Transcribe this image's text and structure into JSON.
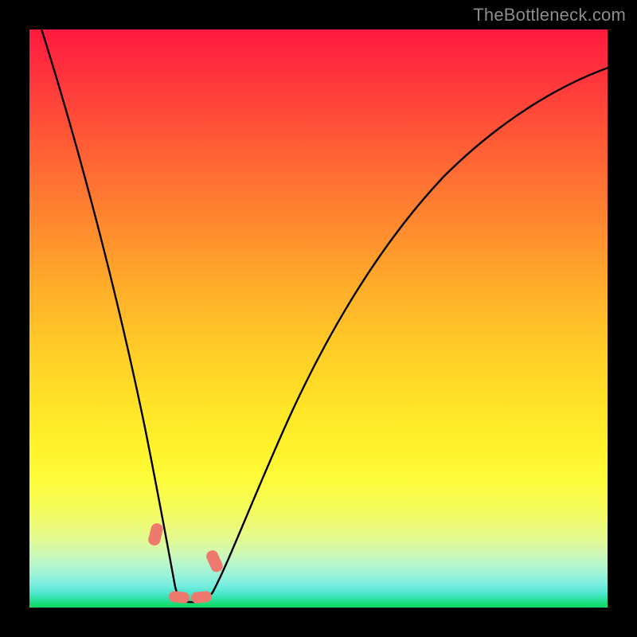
{
  "watermark": "TheBottleneck.com",
  "chart_data": {
    "type": "line",
    "title": "",
    "xlabel": "",
    "ylabel": "",
    "xlim": [
      0,
      100
    ],
    "ylim": [
      0,
      100
    ],
    "grid": false,
    "legend": false,
    "note": "Gradient-background bottleneck curve. x is normalized horizontal position (0–100), y is normalized vertical distance from the bottom green baseline (0 = at baseline, 100 = top). Values are estimated from pixel positions.",
    "series": [
      {
        "name": "bottleneck-curve",
        "x": [
          2,
          5,
          8,
          11,
          14,
          17,
          20,
          22,
          24,
          26,
          27.5,
          29,
          31,
          34,
          38,
          43,
          49,
          56,
          64,
          73,
          83,
          92,
          98
        ],
        "y": [
          100,
          88,
          76,
          64,
          52,
          40,
          28,
          18,
          10,
          4,
          0.8,
          0.5,
          1.5,
          4,
          9,
          17,
          27,
          39,
          52,
          64,
          75,
          83,
          88
        ]
      }
    ],
    "markers": [
      {
        "x": 22.2,
        "y": 13.0,
        "shape": "capsule"
      },
      {
        "x": 25.4,
        "y": 2.0,
        "shape": "capsule"
      },
      {
        "x": 29.0,
        "y": 2.0,
        "shape": "capsule"
      },
      {
        "x": 31.6,
        "y": 9.0,
        "shape": "capsule"
      }
    ],
    "background_gradient": {
      "top": "#ff1a3f",
      "mid": "#ffe127",
      "bottom": "#12db65"
    }
  }
}
